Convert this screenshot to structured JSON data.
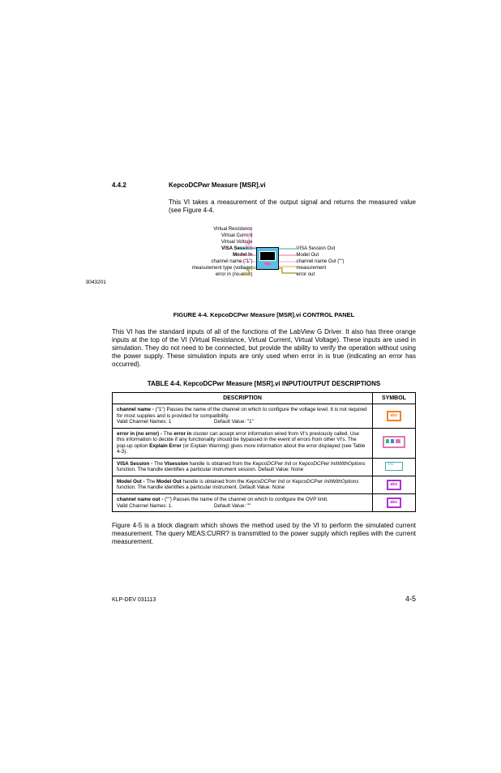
{
  "section": {
    "number": "4.4.2",
    "title": "KepcoDCPwr Measure [MSR].vi",
    "intro": "This VI takes a measurement of the output signal and returns the measured value (see Figure 4-4."
  },
  "figure": {
    "ref": "3043201",
    "caption": "FIGURE 4-4.   KepcoDCPwr Measure [MSR].vi CONTROL PANEL",
    "left_labels": {
      "vres": "Virtual Resistance",
      "vcur": "Virtual Current",
      "vvolt": "Virtual Voltage",
      "visa": "VISA Session",
      "model": "Model In",
      "chan": "channel name (\"1\")",
      "mtype": "measurement type (voltage)",
      "errin": "error in (no error)"
    },
    "right_labels": {
      "visa_out": "VISA Session Out",
      "model_out": "Model Out",
      "chan_out": "channel name Out (\"\")",
      "meas": "measurement",
      "errout": "error out"
    }
  },
  "para2": "This VI has the standard inputs of all of the functions of the LabView G Driver. It also has three orange inputs at the top of the VI (Virtual Resistance, Virtual Current, Virtual Voltage). These inputs are used in simulation. They do not need to be connected, but provide the ability to verify the operation without using the power supply.   These simulation inputs are only used when error in is true (indicating an error has occurred).",
  "table": {
    "caption": "TABLE 4-4.  KepcoDCPwr Measure [MSR].vi INPUT/OUTPUT DESCRIPTIONS",
    "head": {
      "desc": "DESCRIPTION",
      "sym": "SYMBOL"
    },
    "rows": [
      {
        "label": "channel name - ",
        "text": "(\"1\") Passes the name of the channel on which to configure the voltage level. It is not required for most supplies and is provided for compatibility.",
        "line2_a": "Valid Channel Names: 1",
        "line2_b": "Default Value:  \"1\"",
        "sym": "abc"
      },
      {
        "label": "error in (no error) - ",
        "text_a": "The ",
        "bold_a": "error in",
        "text_b": " cluster can accept error information wired from VI's previously called. Use this information to decide if any functionality should be bypassed in the event of errors from other VI's. The pop-up option ",
        "bold_b": "Explain Error",
        "text_c": " (or Explain Warning) gives more information about the error displayed (see Table 4-3).",
        "sym": "error"
      },
      {
        "label": "VISA Session - ",
        "text_a": "The ",
        "bold_a": "VIsession",
        "text_b": " handle is obtained from the ",
        "ital_a": "KepcoDCPwr Init",
        "text_c": " or ",
        "ital_b": "KepcoDCPwr InitWithOptions",
        "text_d": " function. The handle identifies a particular instrument session. Default Value: None",
        "sym": "io"
      },
      {
        "label": "Model Out - ",
        "text_a": "The ",
        "bold_a": "Model Out",
        "text_b": " handle is obtained from the ",
        "ital_a": "KepcoDCPwr Init",
        "text_c": " or ",
        "ital_b": "KepcoDCPwr InitWithOptions",
        "text_d": " function. The handle identifies a particular instrument.   Default Value: None",
        "sym": "abc"
      },
      {
        "label": "channel name out - ",
        "text": "(\"\") Passes the name of the channel on which to configure the OVP limit.",
        "line2_a": "Valid Channel Names: 1.",
        "line2_b": "Default Value: \"\"",
        "sym": "abc"
      }
    ]
  },
  "para3": "Figure 4-5 is a block diagram which shows the method used by the VI to perform the simulated current measurement. The query MEAS:CURR? is transmitted to the power supply which replies with the current measurement.",
  "footer": {
    "left": "KLP-DEV 031113",
    "right": "4-5"
  }
}
